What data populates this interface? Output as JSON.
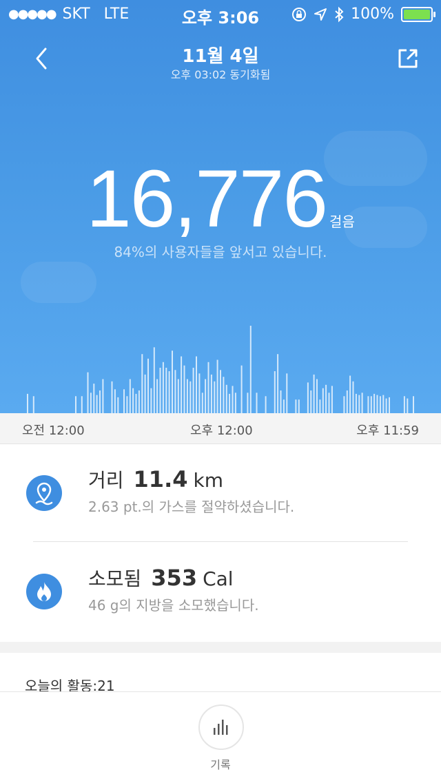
{
  "status_bar": {
    "signal_dots": "●●●●●",
    "carrier": "SKT",
    "network": "LTE",
    "time": "오후 3:06",
    "battery_percent": "100%",
    "icons": [
      "lock-rotation-icon",
      "location-icon",
      "bluetooth-icon",
      "battery-icon"
    ],
    "battery_color": "#7ce04f"
  },
  "header": {
    "title": "11월 4일",
    "subtitle": "오후 03:02 동기화됨",
    "back_icon": "back-chevron-icon",
    "share_icon": "share-icon"
  },
  "steps": {
    "value": "16,776",
    "unit": "걸음",
    "comparison": "84%의 사용자들을 앞서고 있습니다."
  },
  "chart_data": {
    "type": "bar",
    "x_start_label": "오전 12:00",
    "x_mid_label": "오후 12:00",
    "x_end_label": "오후 11:59",
    "bar_color": "#ffffff",
    "values": [
      0.17,
      0,
      0.15,
      0,
      0,
      0,
      0,
      0,
      0,
      0,
      0,
      0,
      0,
      0,
      0,
      0,
      0.15,
      0,
      0.15,
      0,
      0.36,
      0.18,
      0.26,
      0.16,
      0.2,
      0.3,
      0,
      0,
      0.28,
      0.21,
      0.14,
      0,
      0.21,
      0.15,
      0.3,
      0.22,
      0.17,
      0.2,
      0.52,
      0.34,
      0.48,
      0.22,
      0.58,
      0.3,
      0.4,
      0.45,
      0.4,
      0.37,
      0.55,
      0.38,
      0.3,
      0.5,
      0.42,
      0.3,
      0.28,
      0.4,
      0.5,
      0.35,
      0.18,
      0.3,
      0.45,
      0.34,
      0.28,
      0.47,
      0.38,
      0.32,
      0.25,
      0.17,
      0.24,
      0.18,
      0,
      0.42,
      0,
      0.18,
      0.77,
      0,
      0.18,
      0,
      0,
      0.15,
      0,
      0,
      0.37,
      0.52,
      0.2,
      0.12,
      0.35,
      0,
      0,
      0.12,
      0.12,
      0,
      0,
      0.27,
      0.2,
      0.34,
      0.3,
      0.12,
      0.22,
      0.25,
      0.18,
      0.24,
      0,
      0,
      0,
      0.15,
      0.2,
      0.33,
      0.28,
      0.17,
      0.16,
      0.18,
      0,
      0.15,
      0.15,
      0.17,
      0.16,
      0.15,
      0.16,
      0.13,
      0.14,
      0,
      0,
      0,
      0,
      0.15,
      0.13,
      0,
      0.15
    ]
  },
  "metrics": [
    {
      "label": "거리",
      "value": "11.4",
      "unit": "km",
      "detail": "2.63 pt.의 가스를 절약하셨습니다.",
      "icon": "location-pin-icon"
    },
    {
      "label": "소모됨",
      "value": "353",
      "unit": "Cal",
      "detail": "46 g의 지방을 소모했습니다.",
      "icon": "flame-icon"
    }
  ],
  "activity": {
    "label": "오늘의 활동:21"
  },
  "bottom_nav": {
    "record_label": "기록",
    "record_icon": "bar-chart-icon"
  },
  "colors": {
    "hero_blue": "#4a9be6",
    "accent": "#3f8ee0"
  }
}
